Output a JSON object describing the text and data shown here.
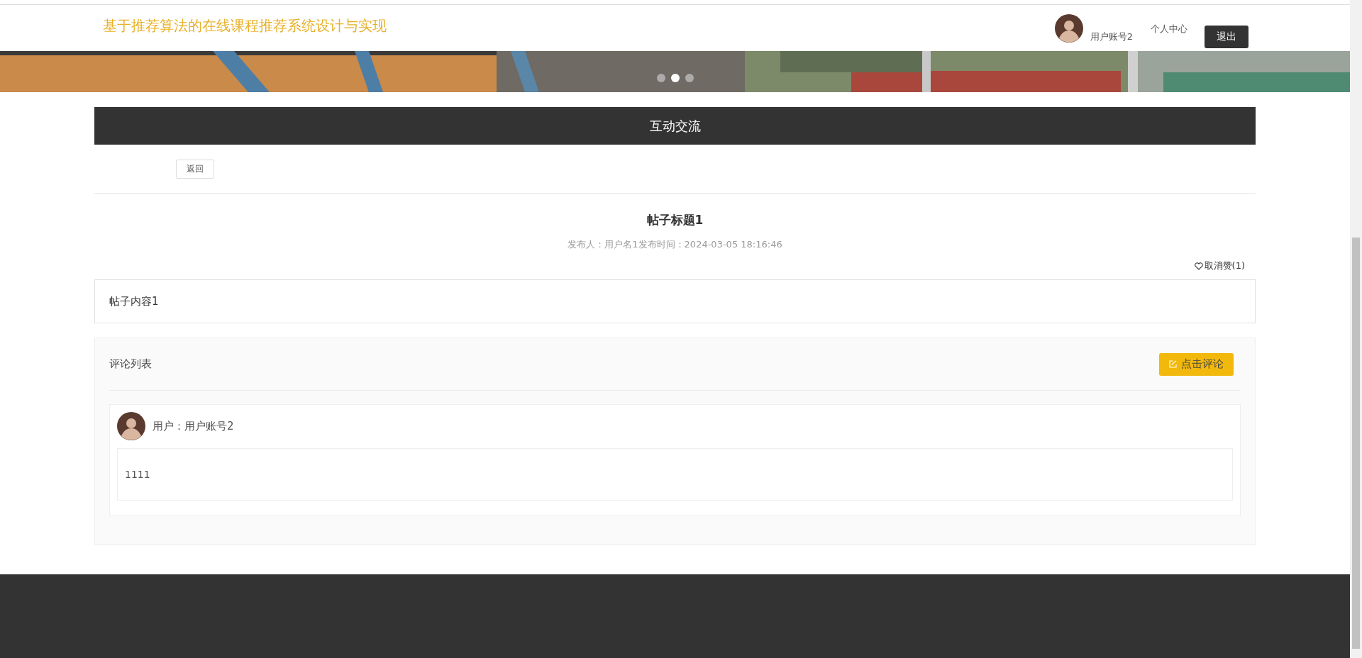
{
  "site": {
    "title": "基于推荐算法的在线课程推荐系统设计与实现"
  },
  "user": {
    "name": "用户账号2"
  },
  "nav": [
    {
      "label": "个人中心"
    }
  ],
  "logout_button": "退出",
  "banner": {
    "kind": "picture",
    "slides": [
      {
        "selected": false
      },
      {
        "selected": true
      },
      {
        "selected": false
      }
    ]
  },
  "section_title": "互动交流",
  "back_button": "返回",
  "post": {
    "title": "帖子标题1",
    "meta": "发布人：用户名1发布时间：2024-03-05 18:16:46",
    "like_label": "取消赞(1)",
    "content": "帖子内容1"
  },
  "comments": {
    "heading": "评论列表",
    "add_button": "点击评论",
    "items": [
      {
        "user": "用户：用户账号2",
        "text": "1111"
      }
    ]
  }
}
